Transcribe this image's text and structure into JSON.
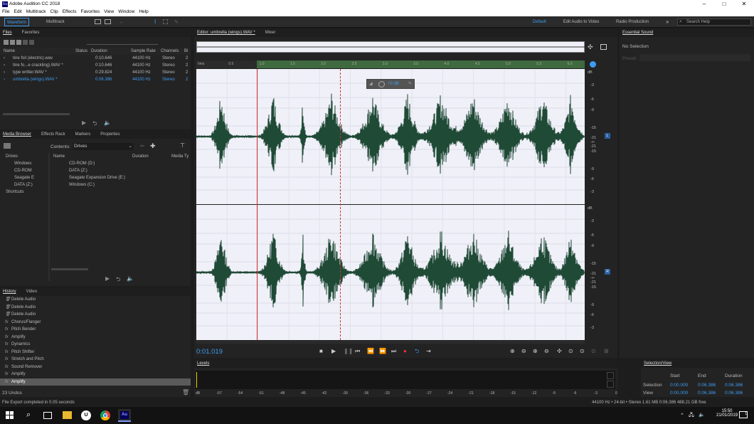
{
  "window": {
    "title": "Adobe Audition CC 2018",
    "app_icon": "Au",
    "minimize": "–",
    "maximize": "□",
    "close": "✕"
  },
  "menu": [
    "File",
    "Edit",
    "Multitrack",
    "Clip",
    "Effects",
    "Favorites",
    "View",
    "Window",
    "Help"
  ],
  "toolbar": {
    "waveform": "Waveform",
    "multitrack": "Multitrack",
    "workspaces": [
      "Default",
      "Edit Audio to Video",
      "Radio Production"
    ],
    "more": "»",
    "search_placeholder": "Search Help"
  },
  "files_panel": {
    "tabs": [
      "Files",
      "Favorites"
    ],
    "columns": [
      "Name",
      "Status",
      "Duration",
      "Sample Rate",
      "Channels",
      "Bi"
    ],
    "rows": [
      {
        "name": "tine foil (electric).wav",
        "duration": "0:10.646",
        "rate": "44100 Hz",
        "channels": "Stereo",
        "bits": "2",
        "selected": false
      },
      {
        "name": "tine fo...e crackling).WAV *",
        "duration": "0:10.646",
        "rate": "44100 Hz",
        "channels": "Stereo",
        "bits": "2",
        "selected": false
      },
      {
        "name": "type writter.WAV *",
        "duration": "0:29.824",
        "rate": "44100 Hz",
        "channels": "Stereo",
        "bits": "2",
        "selected": false
      },
      {
        "name": "umbrella (wings).WAV *",
        "duration": "0:06.386",
        "rate": "44100 Hz",
        "channels": "Stereo",
        "bits": "2",
        "selected": true
      }
    ]
  },
  "media_browser": {
    "tabs": [
      "Media Browser",
      "Effects Rack",
      "Markers",
      "Properties"
    ],
    "contents_label": "Contents:",
    "contents_value": "Drives",
    "columns": [
      "Name",
      "Duration",
      "Media Ty"
    ],
    "tree": [
      "Drives",
      "Windows",
      "CD-ROM",
      "Seagate E",
      "DATA (Z:)",
      "Shortcuts"
    ],
    "items": [
      "CD-ROM (D:)",
      "DATA (Z:)",
      "Seagate Expansion Drive (E:)",
      "Windows (C:)"
    ]
  },
  "history": {
    "tabs": [
      "History",
      "Video"
    ],
    "items": [
      "Delete Audio",
      "Delete Audio",
      "Delete Audio",
      "Chorus/Flanger",
      "Pitch Bender",
      "Amplify",
      "Dynamics",
      "Pitch Shifter",
      "Stretch and Pitch",
      "Sound Remover",
      "Amplify",
      "Amplify"
    ],
    "undo_count": "23 Undos"
  },
  "editor": {
    "tab": "Editor: umbrella (wings).WAV *",
    "mixer_tab": "Mixer",
    "timecode": "0:01.019",
    "ruler": [
      "hms",
      "0.5",
      "1.0",
      "1.5",
      "2.0",
      "2.5",
      "3.0",
      "3.5",
      "4.0",
      "4.5",
      "5.0",
      "5.5",
      "6.0"
    ],
    "db_label": "dB",
    "db_scale": [
      "-3",
      "-6",
      "-9",
      "-15",
      "-21",
      "-∞",
      "-21",
      "-15",
      "-9",
      "-6",
      "-3"
    ],
    "channel_l": "L",
    "channel_r": "R",
    "hud_gain": "+0 dB"
  },
  "essential": {
    "tab": "Essential Sound",
    "no_selection": "No Selection",
    "preset": "Preset:"
  },
  "levels": {
    "tab": "Levels",
    "scale": [
      "dB",
      "-57",
      "-54",
      "-51",
      "-48",
      "-45",
      "-42",
      "-39",
      "-36",
      "-33",
      "-30",
      "-27",
      "-24",
      "-21",
      "-18",
      "-15",
      "-12",
      "-9",
      "-6",
      "-3",
      "0"
    ]
  },
  "selview": {
    "tab": "Selection/View",
    "headers": [
      "Start",
      "End",
      "Duration"
    ],
    "selection": {
      "label": "Selection",
      "start": "0:00.000",
      "end": "0:06.386",
      "dur": "0:06.386"
    },
    "view": {
      "label": "View",
      "start": "0:00.000",
      "end": "0:06.386",
      "dur": "0:06.386"
    }
  },
  "status": {
    "left": "File Export completed in 0.05 seconds",
    "right": "44100 Hz • 24-bit • Stereo   1.61 MB     0:06.386   488.21 GB free"
  },
  "taskbar": {
    "time": "15:50",
    "date": "21/01/2019",
    "notif_count": "1"
  }
}
